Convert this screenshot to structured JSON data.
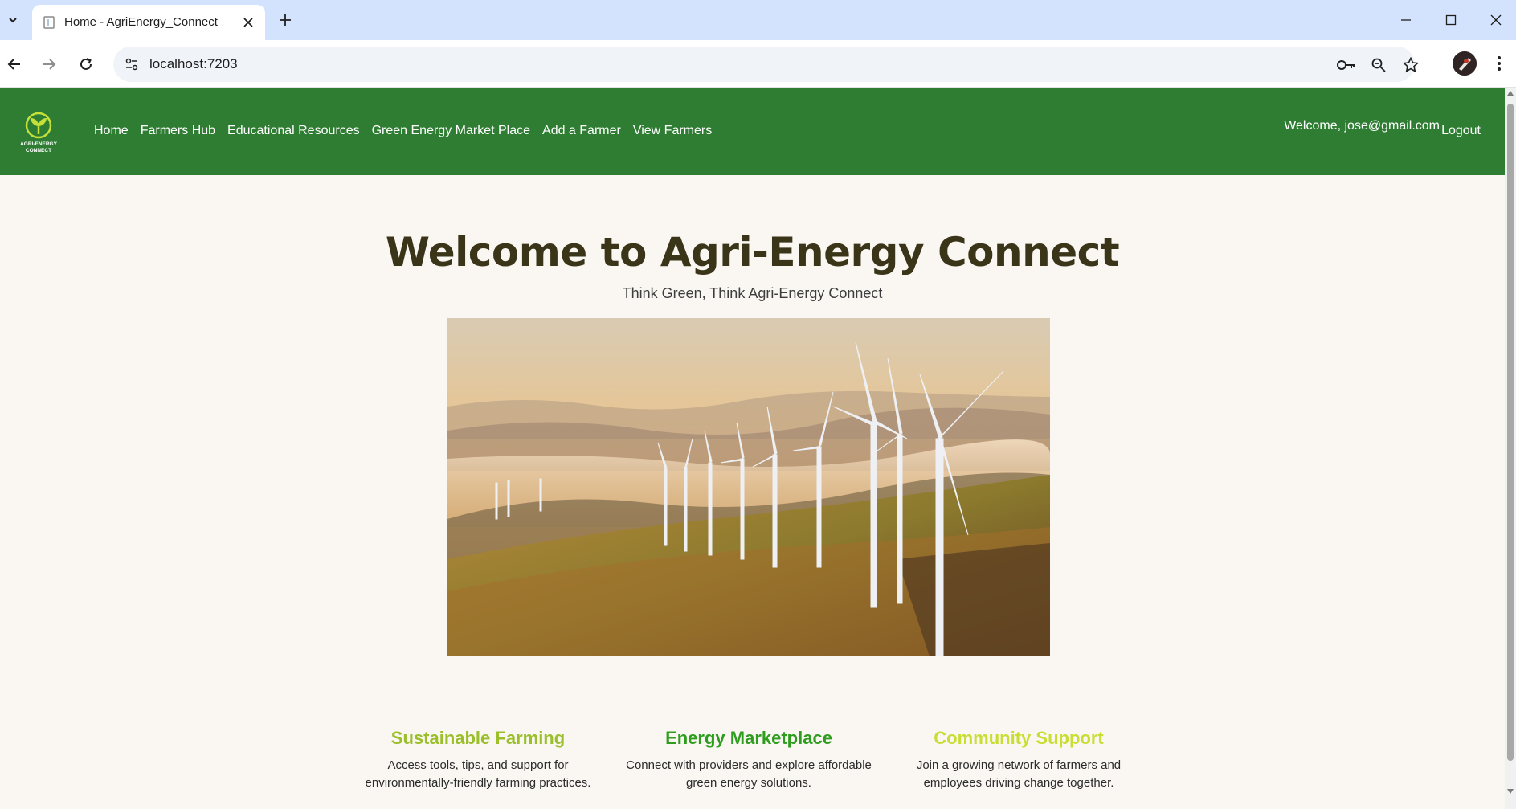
{
  "browser": {
    "tab_title": "Home - AgriEnergy_Connect",
    "url": "localhost:7203",
    "icons": [
      "tab-list-icon",
      "close-icon",
      "plus-icon",
      "minimize-icon",
      "maximize-icon",
      "close-window-icon",
      "back-icon",
      "forward-icon",
      "reload-icon",
      "site-info-icon",
      "key-icon",
      "zoom-icon",
      "star-icon",
      "profile-avatar-icon",
      "more-vert-icon"
    ]
  },
  "nav": {
    "logo_text": "AGRI-ENERGY CONNECT",
    "links": [
      "Home",
      "Farmers Hub",
      "Educational Resources",
      "Green Energy Market Place",
      "Add a Farmer",
      "View Farmers"
    ],
    "welcome": "Welcome, jose@gmail.com",
    "logout": "Logout",
    "color": "#2e7d32"
  },
  "hero": {
    "title": "Welcome to Agri-Energy Connect",
    "subtitle": "Think Green, Think Agri-Energy Connect",
    "image_subject": "wind-turbines-on-hills-at-sunrise"
  },
  "features": [
    {
      "title": "Sustainable Farming",
      "text": "Access tools, tips, and support for environmentally-friendly farming practices.",
      "color": "#9abf2a"
    },
    {
      "title": "Energy Marketplace",
      "text": "Connect with providers and explore affordable green energy solutions.",
      "color": "#2e9d1e"
    },
    {
      "title": "Community Support",
      "text": "Join a growing network of farmers and employees driving change together.",
      "color": "#c8de32"
    }
  ]
}
